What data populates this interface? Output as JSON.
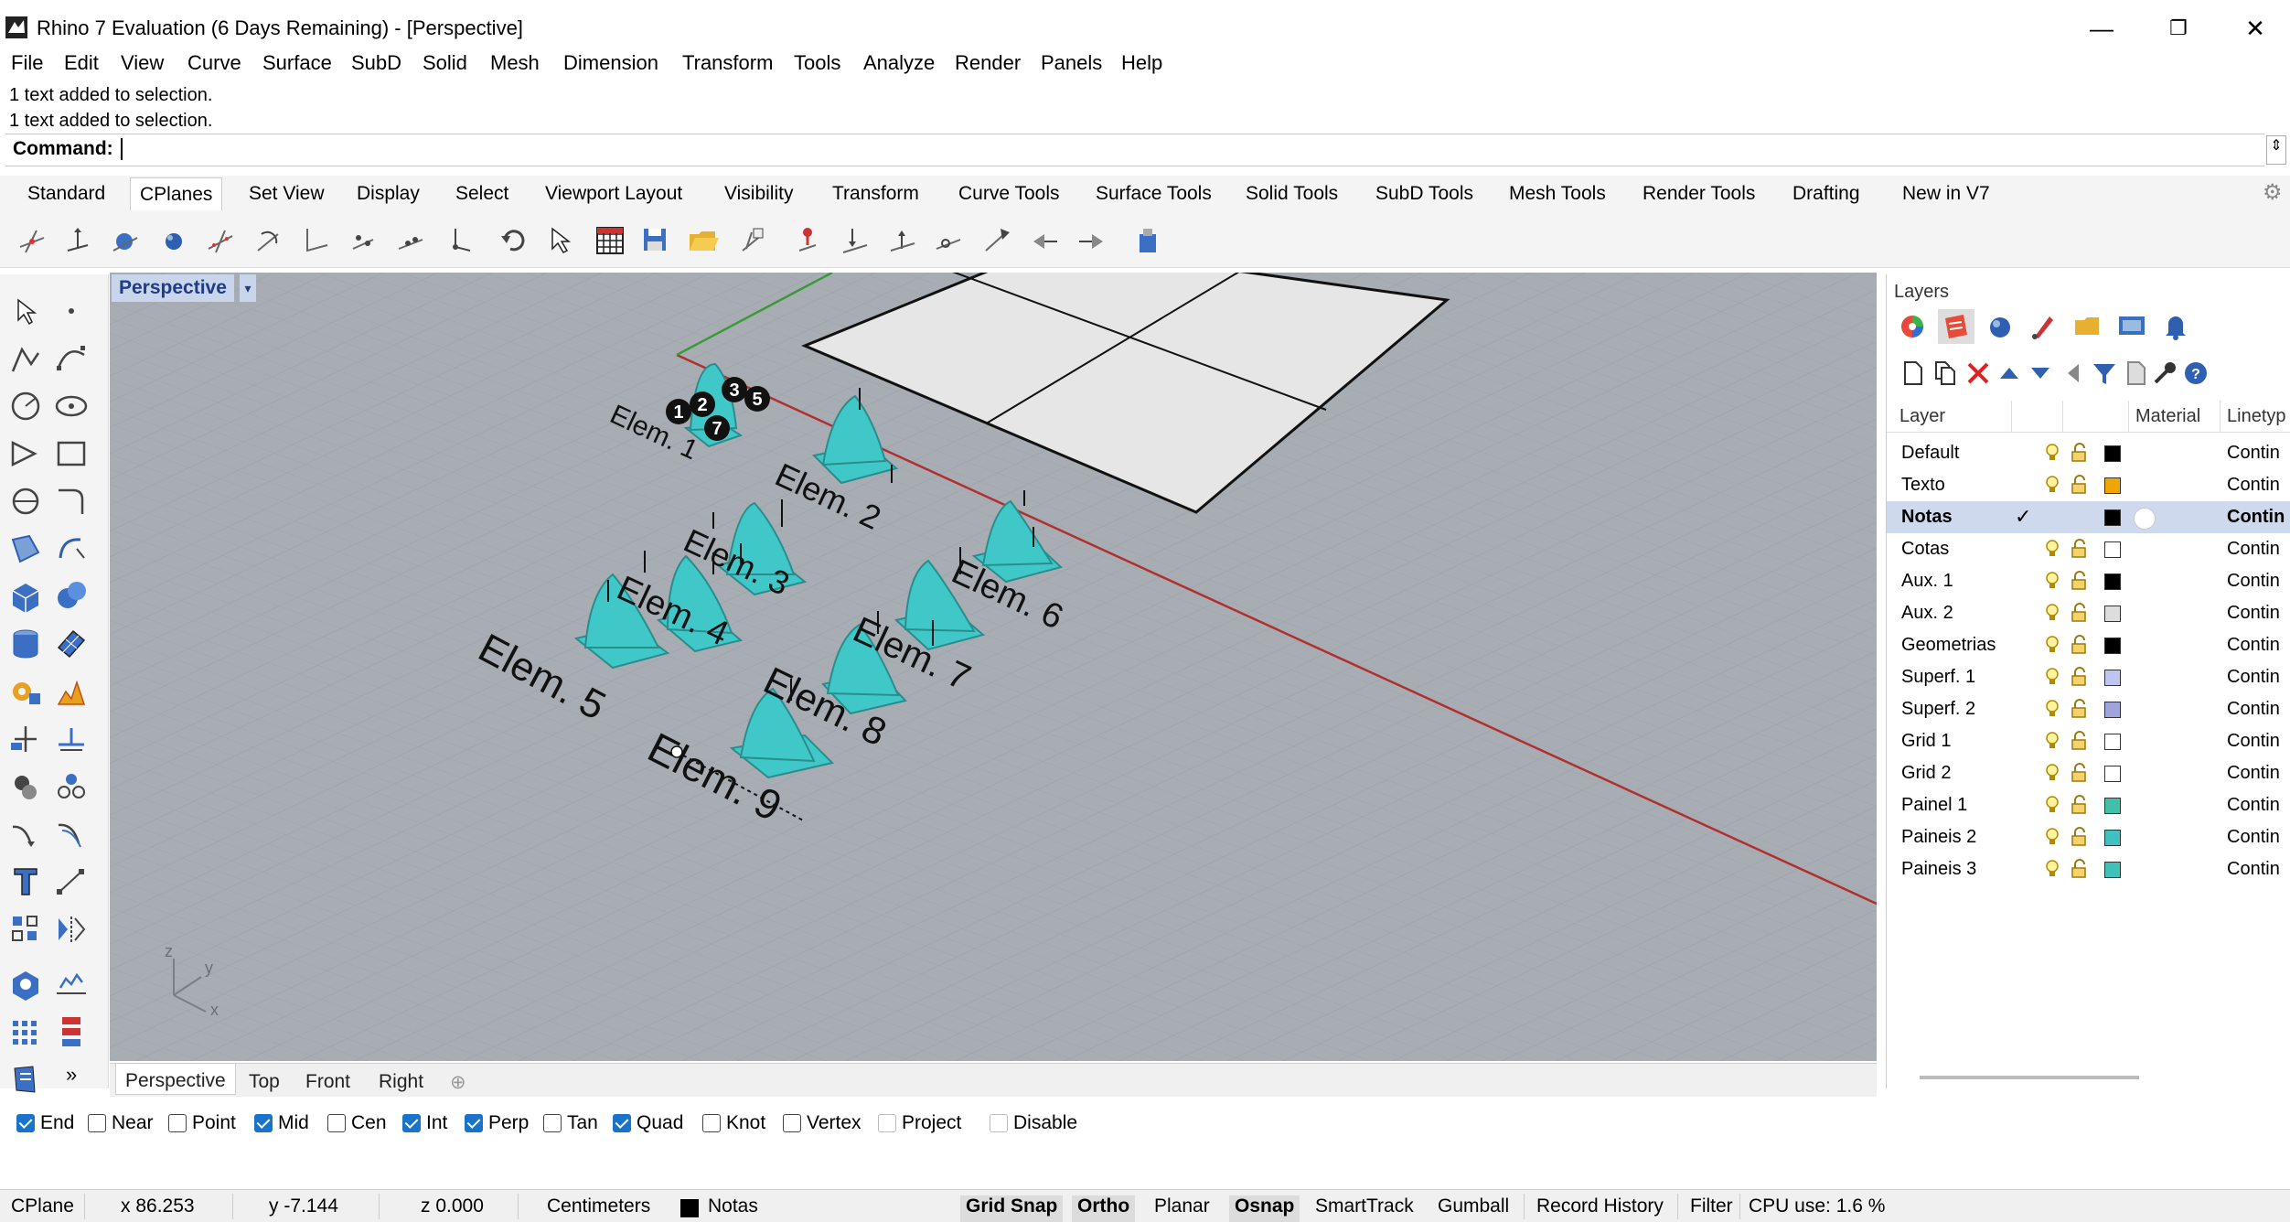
{
  "window": {
    "title": "Rhino 7 Evaluation (6 Days Remaining) - [Perspective]",
    "min": "—",
    "max": "❐",
    "close": "✕"
  },
  "menu": [
    "File",
    "Edit",
    "View",
    "Curve",
    "Surface",
    "SubD",
    "Solid",
    "Mesh",
    "Dimension",
    "Transform",
    "Tools",
    "Analyze",
    "Render",
    "Panels",
    "Help"
  ],
  "command": {
    "history": [
      "1 text added to selection.",
      "1 text added to selection."
    ],
    "label": "Command:",
    "value": ""
  },
  "tabs": [
    "Standard",
    "CPlanes",
    "Set View",
    "Display",
    "Select",
    "Viewport Layout",
    "Visibility",
    "Transform",
    "Curve Tools",
    "Surface Tools",
    "Solid Tools",
    "SubD Tools",
    "Mesh Tools",
    "Render Tools",
    "Drafting",
    "New in V7"
  ],
  "active_tab": "CPlanes",
  "viewport": {
    "name": "Perspective",
    "axis_y": "y",
    "axis_z": "z",
    "axis_x": "x",
    "labels": [
      "Elem. 1",
      "Elem. 2",
      "Elem. 3",
      "Elem. 4",
      "Elem. 5",
      "Elem. 6",
      "Elem. 7",
      "Elem. 8",
      "Elem. 9"
    ],
    "badges": [
      "1",
      "2",
      "3",
      "5",
      "7"
    ],
    "object_color": "#40c8c8",
    "world_x_axis_color": "#b03030",
    "world_y_axis_color": "#3a9a3a"
  },
  "viewport_tabs": [
    "Perspective",
    "Top",
    "Front",
    "Right"
  ],
  "viewport_tabs_add": "⊕",
  "left_toolbar_more": "»",
  "osnaps": [
    {
      "label": "End",
      "checked": true
    },
    {
      "label": "Near",
      "checked": false
    },
    {
      "label": "Point",
      "checked": false
    },
    {
      "label": "Mid",
      "checked": true
    },
    {
      "label": "Cen",
      "checked": false
    },
    {
      "label": "Int",
      "checked": true
    },
    {
      "label": "Perp",
      "checked": true
    },
    {
      "label": "Tan",
      "checked": false
    },
    {
      "label": "Quad",
      "checked": true
    },
    {
      "label": "Knot",
      "checked": false
    },
    {
      "label": "Vertex",
      "checked": false
    },
    {
      "label": "Project",
      "checked": false
    },
    {
      "label": "Disable",
      "checked": false
    }
  ],
  "status": {
    "cplane": "CPlane",
    "x": "x 86.253",
    "y": "y -7.144",
    "z": "z 0.000",
    "units": "Centimeters",
    "layer": "Notas",
    "layer_color": "#000000",
    "grid_snap": "Grid Snap",
    "ortho": "Ortho",
    "planar": "Planar",
    "osnap": "Osnap",
    "smarttrack": "SmartTrack",
    "gumball": "Gumball",
    "record_history": "Record History",
    "filter": "Filter",
    "cpu": "CPU use: 1.6 %"
  },
  "layers_panel": {
    "title": "Layers",
    "col_layer": "Layer",
    "col_material": "Material",
    "col_linetype": "Linetyp",
    "rows": [
      {
        "name": "Default",
        "color": "#000000",
        "linetype": "Contin"
      },
      {
        "name": "Texto",
        "color": "#f0a500",
        "linetype": "Contin"
      },
      {
        "name": "Notas",
        "color": "#000000",
        "linetype": "Contin",
        "selected": true,
        "current_mark": "✓"
      },
      {
        "name": "Cotas",
        "color": "#ffffff",
        "linetype": "Contin"
      },
      {
        "name": "Aux. 1",
        "color": "#000000",
        "linetype": "Contin"
      },
      {
        "name": "Aux. 2",
        "color": "#dddddd",
        "linetype": "Contin"
      },
      {
        "name": "Geometrias",
        "color": "#000000",
        "linetype": "Contin"
      },
      {
        "name": "Superf. 1",
        "color": "#c0c4f0",
        "linetype": "Contin"
      },
      {
        "name": "Superf. 2",
        "color": "#a0a4dc",
        "linetype": "Contin"
      },
      {
        "name": "Grid 1",
        "color": "#ffffff",
        "linetype": "Contin"
      },
      {
        "name": "Grid 2",
        "color": "#ffffff",
        "linetype": "Contin"
      },
      {
        "name": "Painel 1",
        "color": "#40c0a8",
        "linetype": "Contin"
      },
      {
        "name": "Paineis 2",
        "color": "#40c0c0",
        "linetype": "Contin"
      },
      {
        "name": "Paineis 3",
        "color": "#40c0b8",
        "linetype": "Contin"
      }
    ]
  }
}
